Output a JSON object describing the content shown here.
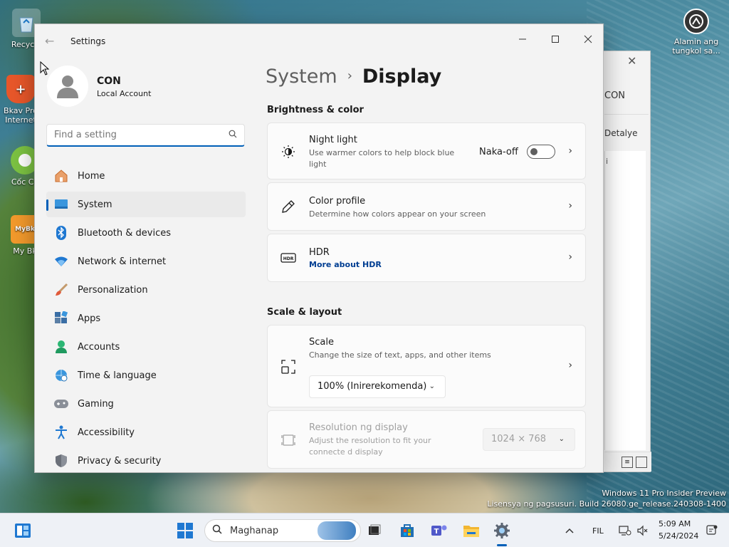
{
  "desktop": {
    "icons_left": [
      {
        "label": "Recycle",
        "icon": "recycle-bin-icon"
      },
      {
        "label": "Bkav Pro Internet",
        "icon": "bkav-icon"
      },
      {
        "label": "Cốc Cố",
        "icon": "coccoc-icon"
      },
      {
        "label": "My Bk",
        "icon": "mybkav-icon"
      }
    ],
    "icon_right": {
      "label": "Alamin ang tungkol sa...",
      "icon": "info-icon"
    },
    "watermark": {
      "line1": "Windows 11 Pro Insider Preview",
      "line2": "Lisensya ng pagsusuri. Build 26080.ge_release.240308-1400"
    }
  },
  "background_window": {
    "text1": "CON",
    "text2": "Detalye",
    "text3": "i"
  },
  "settings": {
    "title": "Settings",
    "user": {
      "name": "CON",
      "account_type": "Local Account"
    },
    "search": {
      "placeholder": "Find a setting"
    },
    "nav": [
      {
        "label": "Home",
        "icon": "home-icon",
        "active": false
      },
      {
        "label": "System",
        "icon": "monitor-icon",
        "active": true
      },
      {
        "label": "Bluetooth & devices",
        "icon": "bluetooth-icon",
        "active": false
      },
      {
        "label": "Network & internet",
        "icon": "wifi-icon",
        "active": false
      },
      {
        "label": "Personalization",
        "icon": "brush-icon",
        "active": false
      },
      {
        "label": "Apps",
        "icon": "apps-icon",
        "active": false
      },
      {
        "label": "Accounts",
        "icon": "person-icon",
        "active": false
      },
      {
        "label": "Time & language",
        "icon": "globe-clock-icon",
        "active": false
      },
      {
        "label": "Gaming",
        "icon": "gamepad-icon",
        "active": false
      },
      {
        "label": "Accessibility",
        "icon": "accessibility-icon",
        "active": false
      },
      {
        "label": "Privacy & security",
        "icon": "shield-icon",
        "active": false
      }
    ],
    "breadcrumb": {
      "parent": "System",
      "separator": "›",
      "current": "Display"
    },
    "sections": {
      "brightness": {
        "title": "Brightness & color",
        "night_light": {
          "title": "Night light",
          "desc": "Use warmer colors to help block blue light",
          "toggle_label": "Naka-off",
          "toggle_on": false
        },
        "color_profile": {
          "title": "Color profile",
          "desc": "Determine how colors appear on your screen"
        },
        "hdr": {
          "title": "HDR",
          "link": "More about HDR"
        }
      },
      "scale_layout": {
        "title": "Scale & layout",
        "scale": {
          "title": "Scale",
          "desc": "Change the size of text, apps, and other items",
          "value": "100% (Inirerekomenda)"
        },
        "resolution": {
          "title": "Resolution ng display",
          "desc": "Adjust the resolution to fit your connecte d display",
          "value": "1024 × 768"
        }
      }
    }
  },
  "taskbar": {
    "search_placeholder": "Maghanap",
    "language": "FIL",
    "time": "5:09 AM",
    "date": "5/24/2024",
    "accent": "#005fb8"
  }
}
